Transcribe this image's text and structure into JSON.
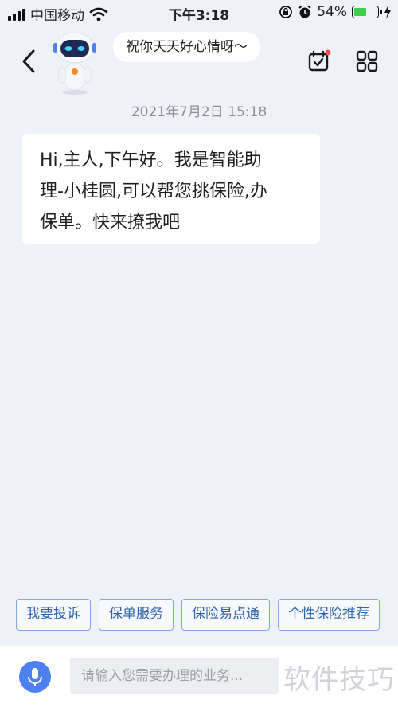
{
  "status_bar": {
    "carrier": "中国移动",
    "time": "下午3:18",
    "battery_percent": "54%",
    "battery_level": 0.54,
    "icons": [
      "signal-icon",
      "wifi-icon",
      "orientation-lock-icon",
      "alarm-icon",
      "battery-icon",
      "charging-icon"
    ]
  },
  "header": {
    "greeting": "祝你天天好心情呀～",
    "icons": [
      "back-arrow-icon",
      "robot-avatar",
      "calendar-check-icon",
      "grid-menu-icon"
    ],
    "notification_dot_color": "#f0524a"
  },
  "chat": {
    "timestamp": "2021年7月2日 15:18",
    "message_lines": [
      "Hi,主人,下午好。我是智能助",
      "理-小桂圆,可以帮您挑保险,办",
      "保单。快来撩我吧"
    ]
  },
  "quick_replies": [
    "我要投诉",
    "保单服务",
    "保险易点通",
    "个性保险推荐"
  ],
  "input_bar": {
    "placeholder": "请输入您需要办理的业务...",
    "watermark": "软件技巧"
  },
  "colors": {
    "background": "#eef1f7",
    "accent": "#4d80f0",
    "chip_border": "#7ea9e6",
    "chip_text": "#2f63b3"
  }
}
